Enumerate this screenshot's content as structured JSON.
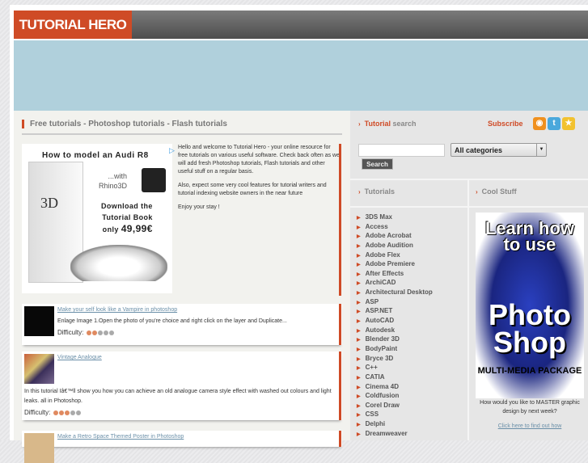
{
  "header": {
    "logo": "TUTORIAL HERO"
  },
  "main": {
    "title": "Free tutorials - Photoshop tutorials - Flash tutorials",
    "ad": {
      "headline": "How to model an Audi R8",
      "with": "...with",
      "product": "Rhino3D",
      "cta1": "Download the",
      "cta2": "Tutorial Book",
      "price_prefix": "only",
      "price": "49,99€",
      "book_title": "3D"
    },
    "intro": [
      "Hello and welcome to Tutorial Hero - your online resource for free tutorials on various useful software. Check back often as we will add fresh Photoshop tutorials, Flash tutorials and other useful stuff on a regular basis.",
      "Also, expect some very cool features for tutorial writers and tutorial indexing website owners in the near future",
      "Enjoy your stay !"
    ],
    "difficulty_label": "Difficulty:",
    "articles": [
      {
        "title": "Make your self look like a Vampire in photoshop",
        "desc": "Enlage Image 1.Open the photo of you're choice and right click on the layer and Duplicate...",
        "difficulty": 2
      },
      {
        "title": "Vintage Analogue",
        "desc": "In this tutorial Iâ€™ll show you how you can achieve an old analogue camera style effect with washed out colours and light leaks. all in Photoshop.",
        "difficulty": 3
      },
      {
        "title": "Make a Retro Space Themed Poster in Photoshop"
      }
    ]
  },
  "sidebar": {
    "search_title_a": "Tutorial",
    "search_title_b": "search",
    "subscribe": "Subscribe",
    "search_value": "",
    "category": "All categories",
    "search_button": "Search",
    "tutorials_heading": "Tutorials",
    "cool_heading": "Cool Stuff",
    "categories": [
      "3DS Max",
      "Access",
      "Adobe Acrobat",
      "Adobe Audition",
      "Adobe Flex",
      "Adobe Premiere",
      "After Effects",
      "ArchiCAD",
      "Architectural Desktop",
      "ASP",
      "ASP.NET",
      "AutoCAD",
      "Autodesk",
      "Blender 3D",
      "BodyPaint",
      "Bryce 3D",
      "C++",
      "CATIA",
      "Cinema 4D",
      "Coldfusion",
      "Corel Draw",
      "CSS",
      "Delphi",
      "Dreamweaver"
    ],
    "promo": {
      "line1": "Learn how to use",
      "line2": "Photo Shop",
      "line3": "MULTI-MEDIA PACKAGE",
      "text": "How would you like to MASTER graphic design by next week?",
      "link": "Click here to find out how"
    }
  },
  "colors": {
    "accent": "#cf4b26",
    "banner": "#b0d0dc",
    "link": "#6a8fa8"
  }
}
